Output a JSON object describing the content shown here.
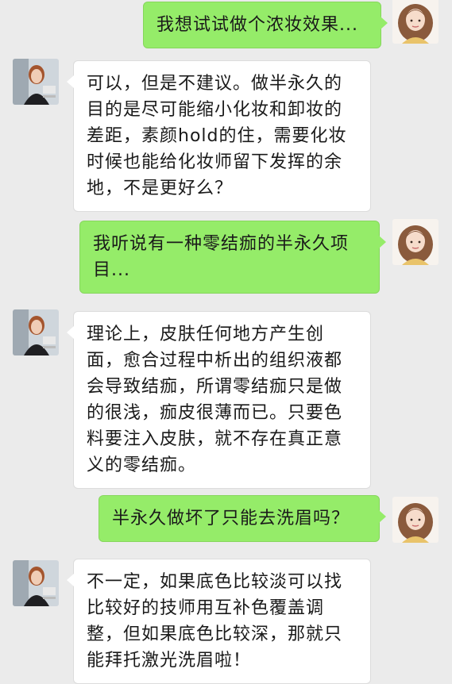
{
  "messages": [
    {
      "side": "out",
      "text": "我想试试做个浓妆效果..."
    },
    {
      "side": "in",
      "text": "可以，但是不建议。做半永久的目的是尽可能缩小化妆和卸妆的差距，素颜hold的住，需要化妆时候也能给化妆师留下发挥的余地，不是更好么？"
    },
    {
      "side": "out",
      "text": "我听说有一种零结痂的半永久项目..."
    },
    {
      "side": "in",
      "text": "理论上，皮肤任何地方产生创面，愈合过程中析出的组织液都会导致结痂，所谓零结痂只是做的很浅，痂皮很薄而已。只要色料要注入皮肤，就不存在真正意义的零结痂。"
    },
    {
      "side": "out",
      "text": "半永久做坏了只能去洗眉吗？"
    },
    {
      "side": "in",
      "text": "不一定，如果底色比较淡可以找比较好的技师用互补色覆盖调整，但如果底色比较深，那就只能拜托激光洗眉啦！"
    }
  ],
  "colors": {
    "background": "#ebebeb",
    "outgoing_bubble": "#95ec69",
    "incoming_bubble": "#ffffff"
  },
  "avatars": {
    "user": "user-avatar",
    "artist": "artist-avatar"
  }
}
